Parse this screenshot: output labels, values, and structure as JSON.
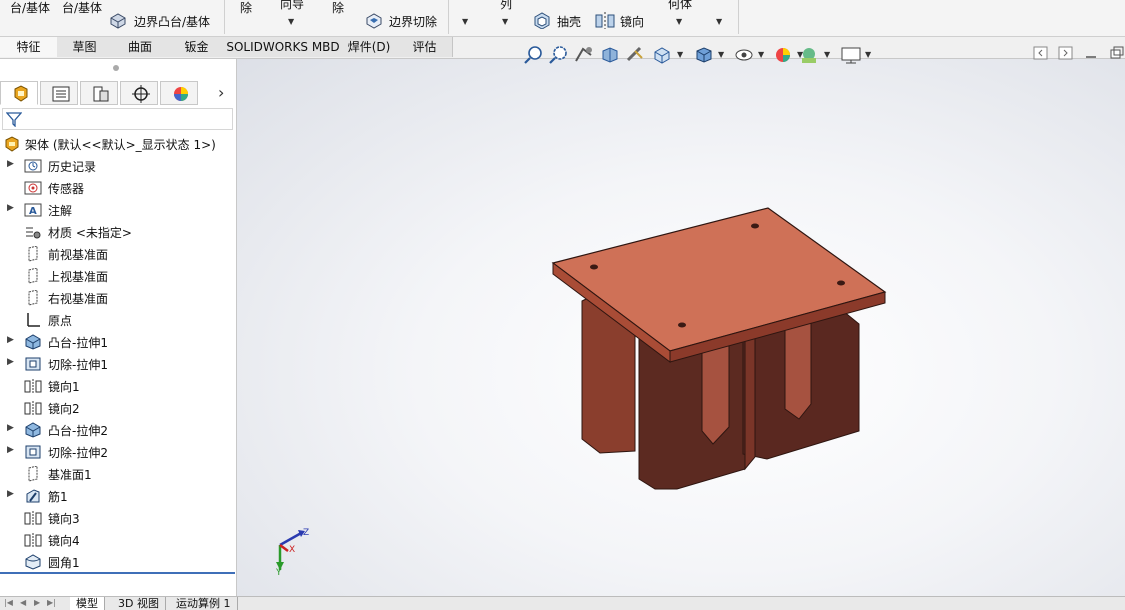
{
  "ribbon": {
    "tl1": "台/基体",
    "tl2": "台/基体",
    "boundary_boss": "边界凸台/基体",
    "cut_partial": "除",
    "sweep_cut_partial": "向导",
    "cut_partial2": "除",
    "boundary_cut": "边界切除",
    "array_partial": "列",
    "shell": "抽壳",
    "mirror": "镜向",
    "geometry_partial": "何体"
  },
  "tabs": [
    "特征",
    "草图",
    "曲面",
    "钣金",
    "SOLIDWORKS MBD",
    "焊件(D)",
    "评估"
  ],
  "feature_tree": {
    "root": "架体 (默认<<默认>_显示状态 1>)",
    "items": [
      {
        "label": "历史记录",
        "icon": "history-icon",
        "expandable": true
      },
      {
        "label": "传感器",
        "icon": "sensor-icon",
        "expandable": false
      },
      {
        "label": "注解",
        "icon": "annotation-icon",
        "expandable": true
      },
      {
        "label": "材质 <未指定>",
        "icon": "material-icon",
        "expandable": false
      },
      {
        "label": "前视基准面",
        "icon": "plane-icon",
        "expandable": false
      },
      {
        "label": "上视基准面",
        "icon": "plane-icon",
        "expandable": false
      },
      {
        "label": "右视基准面",
        "icon": "plane-icon",
        "expandable": false
      },
      {
        "label": "原点",
        "icon": "origin-icon",
        "expandable": false
      },
      {
        "label": "凸台-拉伸1",
        "icon": "boss-extrude-icon",
        "expandable": true
      },
      {
        "label": "切除-拉伸1",
        "icon": "cut-extrude-icon",
        "expandable": true
      },
      {
        "label": "镜向1",
        "icon": "mirror-icon",
        "expandable": false
      },
      {
        "label": "镜向2",
        "icon": "mirror-icon",
        "expandable": false
      },
      {
        "label": "凸台-拉伸2",
        "icon": "boss-extrude-icon",
        "expandable": true
      },
      {
        "label": "切除-拉伸2",
        "icon": "cut-extrude-icon",
        "expandable": true
      },
      {
        "label": "基准面1",
        "icon": "plane-icon",
        "expandable": false
      },
      {
        "label": "筋1",
        "icon": "rib-icon",
        "expandable": true
      },
      {
        "label": "镜向3",
        "icon": "mirror-icon",
        "expandable": false
      },
      {
        "label": "镜向4",
        "icon": "mirror-icon",
        "expandable": false
      },
      {
        "label": "圆角1",
        "icon": "fillet-icon",
        "expandable": false
      }
    ]
  },
  "triad": {
    "x": "X",
    "y": "Y",
    "z": "Z"
  },
  "bottom_tabs": [
    "模型",
    "3D 视图",
    "运动算例 1"
  ],
  "colors": {
    "part_top": "#c86a50",
    "part_side": "#7a3528",
    "part_dark": "#4e211b"
  }
}
